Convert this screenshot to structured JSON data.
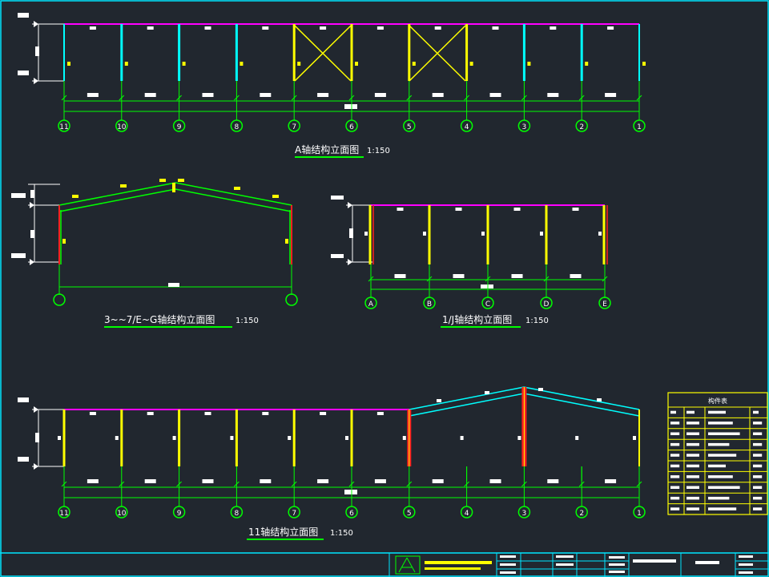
{
  "titles": {
    "elev_a": "A轴结构立面图",
    "elev_b": "3~~7/E~G轴结构立面图",
    "elev_c": "1/J轴结构立面图",
    "elev_d": "11轴结构立面图",
    "scale": "1:150"
  },
  "grid_labels_main": [
    "11",
    "10",
    "9",
    "8",
    "7",
    "6",
    "5",
    "4",
    "3",
    "2",
    "1"
  ],
  "grid_labels_c": [
    "A",
    "B",
    "C",
    "D",
    "E"
  ],
  "table": {
    "title": "构件表",
    "rows": 9
  },
  "colors": {
    "frame": "#00ff00",
    "beam": "#ff00ff",
    "column_cyan": "#00ffff",
    "column_yellow": "#ffff00",
    "column_red": "#ff2020",
    "border": "#00e5ff",
    "white": "#ffffff"
  }
}
